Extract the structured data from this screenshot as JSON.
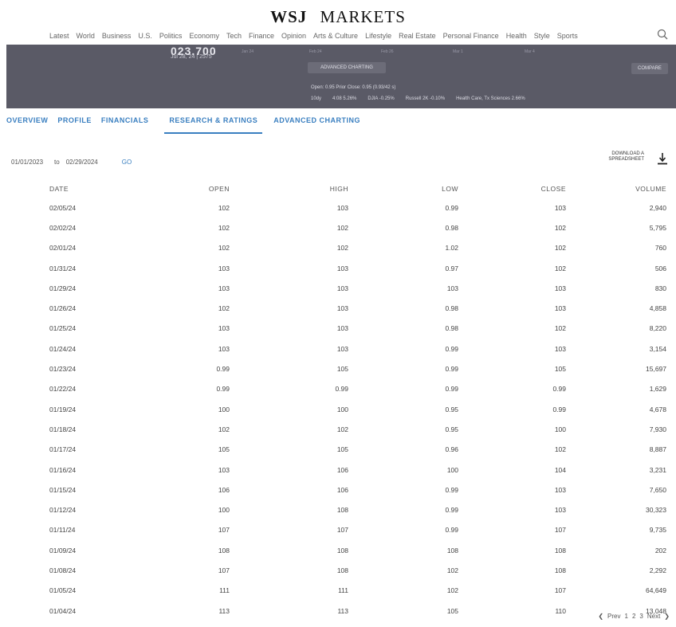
{
  "brand": {
    "wsj": "WSJ",
    "section": "MARKETS"
  },
  "nav": [
    "Latest",
    "World",
    "Business",
    "U.S.",
    "Politics",
    "Economy",
    "Tech",
    "Finance",
    "Opinion",
    "Arts & Culture",
    "Lifestyle",
    "Real Estate",
    "Personal Finance",
    "Health",
    "Style",
    "Sports"
  ],
  "quote": {
    "price": "023.700",
    "price_date": "Jul 28, 24 | 2575",
    "advanced_charting_label": "ADVANCED CHARTING",
    "compare_label": "COMPARE",
    "stats": "Open: 0.95   Prior Close: 0.95 (0.93/42 s)",
    "indices": [
      "10dy",
      "4:08 5.26%",
      "DJIA -0.25%",
      "Russell 2K -0.10%",
      "Health Care, Tx Sciences 2.66%"
    ],
    "axis_ticks": [
      "Jan 24",
      "Feb 24",
      "Feb 26",
      "Mar 1",
      "Mar 4"
    ]
  },
  "tabs": [
    "OVERVIEW",
    "PROFILE",
    "FINANCIALS",
    "RESEARCH & RATINGS",
    "ADVANCED CHARTING"
  ],
  "filter": {
    "from": "01/01/2023",
    "to_label": "to",
    "to": "02/29/2024",
    "go_label": "GO"
  },
  "download": {
    "label_line1": "DOWNLOAD A",
    "label_line2": "SPREADSHEET"
  },
  "table": {
    "headers": [
      "DATE",
      "OPEN",
      "HIGH",
      "LOW",
      "CLOSE",
      "VOLUME"
    ],
    "rows": [
      [
        "02/05/24",
        "102",
        "103",
        "0.99",
        "103",
        "2,940"
      ],
      [
        "02/02/24",
        "102",
        "102",
        "0.98",
        "102",
        "5,795"
      ],
      [
        "02/01/24",
        "102",
        "102",
        "1.02",
        "102",
        "760"
      ],
      [
        "01/31/24",
        "103",
        "103",
        "0.97",
        "102",
        "506"
      ],
      [
        "01/29/24",
        "103",
        "103",
        "103",
        "103",
        "830"
      ],
      [
        "01/26/24",
        "102",
        "103",
        "0.98",
        "103",
        "4,858"
      ],
      [
        "01/25/24",
        "103",
        "103",
        "0.98",
        "102",
        "8,220"
      ],
      [
        "01/24/24",
        "103",
        "103",
        "0.99",
        "103",
        "3,154"
      ],
      [
        "01/23/24",
        "0.99",
        "105",
        "0.99",
        "105",
        "15,697"
      ],
      [
        "01/22/24",
        "0.99",
        "0.99",
        "0.99",
        "0.99",
        "1,629"
      ],
      [
        "01/19/24",
        "100",
        "100",
        "0.95",
        "0.99",
        "4,678"
      ],
      [
        "01/18/24",
        "102",
        "102",
        "0.95",
        "100",
        "7,930"
      ],
      [
        "01/17/24",
        "105",
        "105",
        "0.96",
        "102",
        "8,887"
      ],
      [
        "01/16/24",
        "103",
        "106",
        "100",
        "104",
        "3,231"
      ],
      [
        "01/15/24",
        "106",
        "106",
        "0.99",
        "103",
        "7,650"
      ],
      [
        "01/12/24",
        "100",
        "108",
        "0.99",
        "103",
        "30,323"
      ],
      [
        "01/11/24",
        "107",
        "107",
        "0.99",
        "107",
        "9,735"
      ],
      [
        "01/09/24",
        "108",
        "108",
        "108",
        "108",
        "202"
      ],
      [
        "01/08/24",
        "107",
        "108",
        "102",
        "108",
        "2,292"
      ],
      [
        "01/05/24",
        "111",
        "111",
        "102",
        "107",
        "64,649"
      ],
      [
        "01/04/24",
        "113",
        "113",
        "105",
        "110",
        "13,048"
      ]
    ]
  },
  "pager": {
    "prev": "Prev",
    "pages": [
      "1",
      "2",
      "3"
    ],
    "next": "Next"
  }
}
